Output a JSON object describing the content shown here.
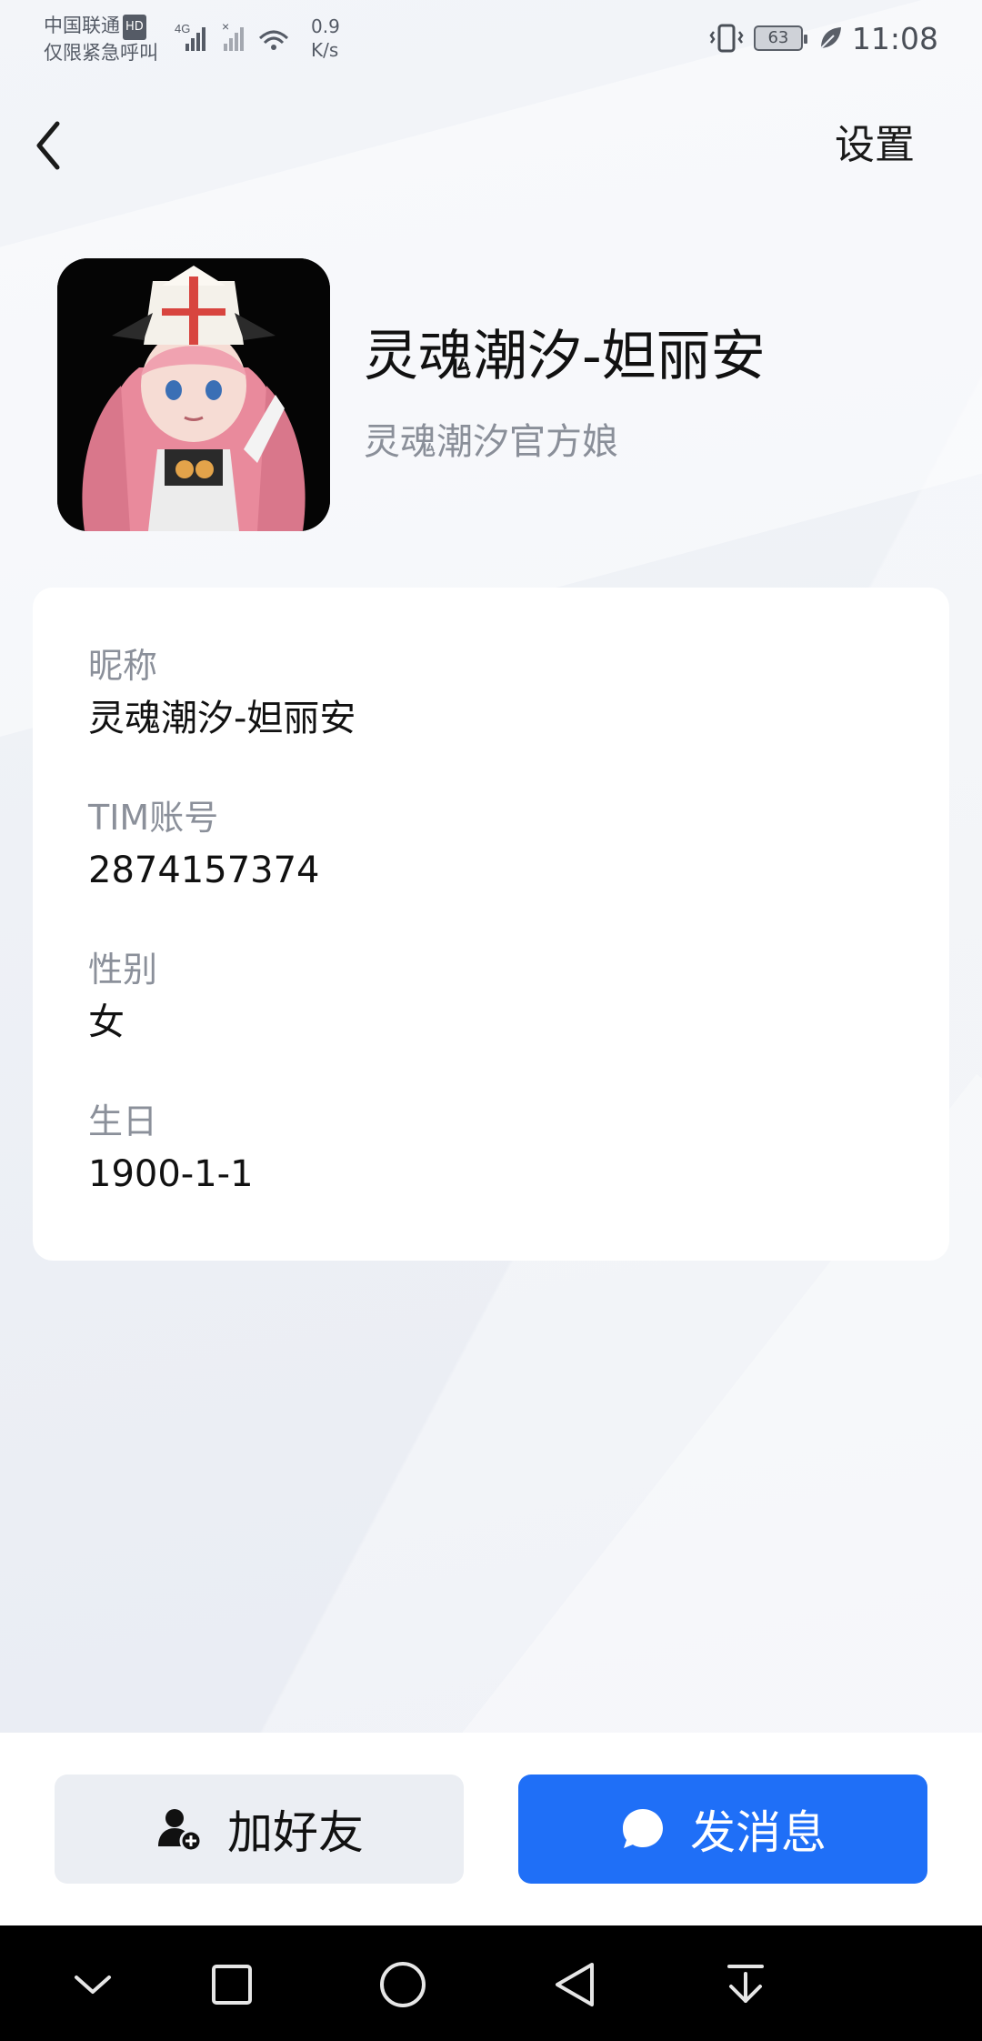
{
  "status_bar": {
    "carrier_line1": "中国联通",
    "carrier_badge": "HD",
    "carrier_line2": "仅限紧急呼叫",
    "network_type": "4G",
    "speed_value": "0.9",
    "speed_unit": "K/s",
    "battery_level": "63",
    "time": "11:08"
  },
  "header": {
    "settings_label": "设置"
  },
  "profile": {
    "name": "灵魂潮汐-妲丽安",
    "subtitle": "灵魂潮汐官方娘"
  },
  "info": {
    "nickname_label": "昵称",
    "nickname_value": "灵魂潮汐-妲丽安",
    "account_label": "TIM账号",
    "account_value": "2874157374",
    "gender_label": "性别",
    "gender_value": "女",
    "birthday_label": "生日",
    "birthday_value": "1900-1-1"
  },
  "actions": {
    "add_friend_label": "加好友",
    "send_message_label": "发消息"
  },
  "colors": {
    "primary_button": "#1f6ff7",
    "secondary_button": "#ebeef3",
    "background": "#eaedf3"
  }
}
